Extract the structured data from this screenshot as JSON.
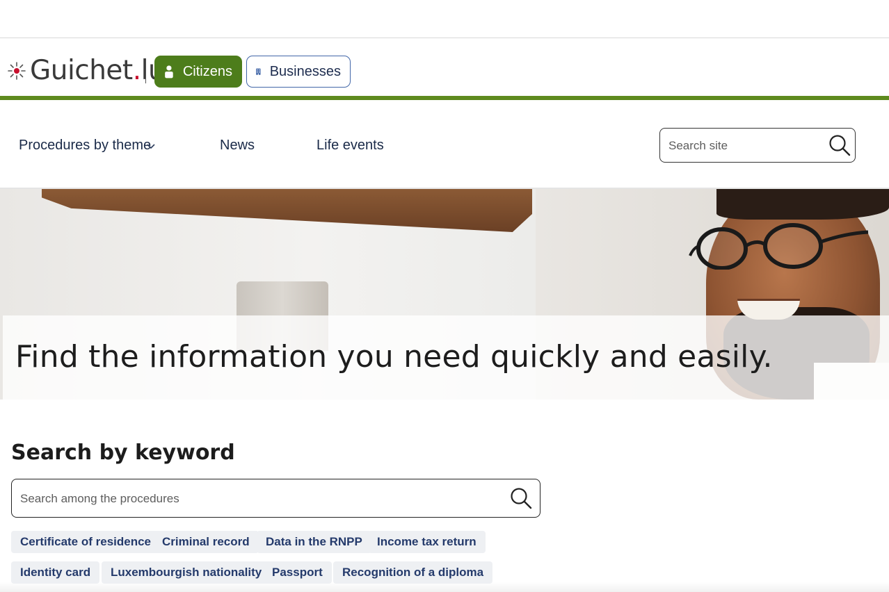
{
  "brand": {
    "logo_main": "Guichet",
    "logo_dot": ".",
    "logo_tld": "lu",
    "accent_color": "#5e8a1e",
    "logo_dot_color": "#c8102e"
  },
  "audience": {
    "citizens_label": "Citizens",
    "businesses_label": "Businesses",
    "selected": "Citizens",
    "citizens_icon": "person-icon",
    "businesses_icon": "building-icon"
  },
  "nav": {
    "procedures_label": "Procedures by theme",
    "news_label": "News",
    "life_events_label": "Life events",
    "site_search_placeholder": "Search site"
  },
  "hero": {
    "title": "Find the information you need quickly and easily."
  },
  "keyword_search": {
    "heading": "Search by keyword",
    "placeholder": "Search among the procedures",
    "tags": [
      "Certificate of residence",
      "Criminal record",
      "Data in the RNPP",
      "Income tax return",
      "Identity card",
      "Luxembourgish nationality",
      "Passport",
      "Recognition of a diploma"
    ]
  }
}
